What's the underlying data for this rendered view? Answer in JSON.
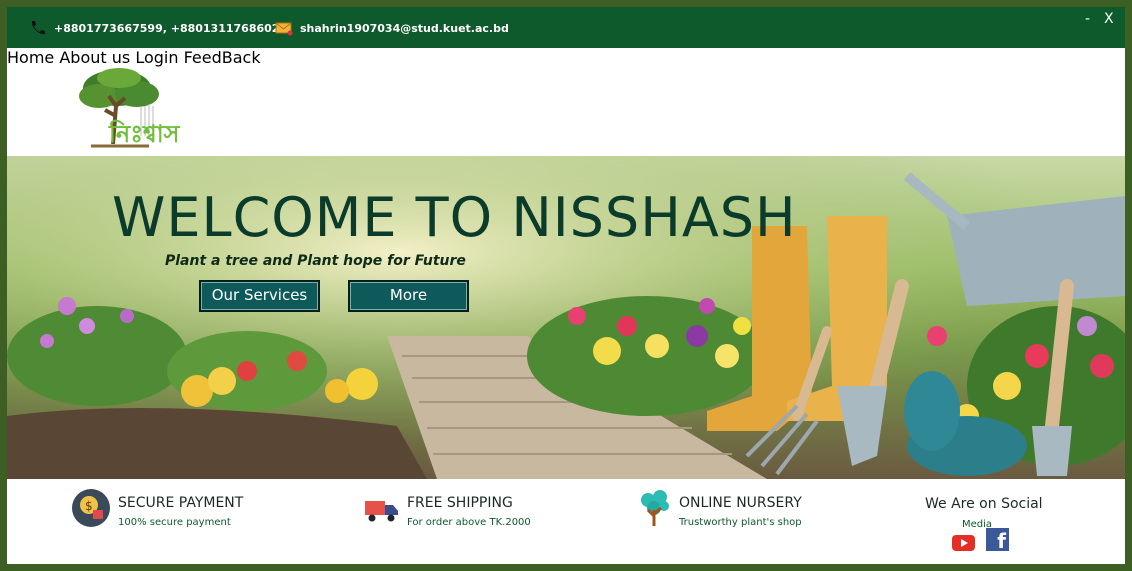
{
  "topbar": {
    "phone": "+8801773667599, +8801311768602",
    "email": "shahrin1907034@stud.kuet.ac.bd",
    "minimize": "-",
    "close": "X",
    "phone_icon": "phone-icon",
    "mail_icon": "mail-icon"
  },
  "header": {
    "logo_text": "নিঃশ্বাস",
    "nav": [
      "Home",
      "About us",
      "Login",
      "FeedBack"
    ]
  },
  "hero": {
    "title": "WELCOME TO NISSHASH",
    "tagline": "Plant a tree and Plant hope for Future",
    "buttons": {
      "services": "Our Services",
      "more": "More"
    }
  },
  "features": [
    {
      "title": "SECURE PAYMENT",
      "subtitle": "100% secure payment",
      "icon": "secure-payment-icon"
    },
    {
      "title": "FREE SHIPPING",
      "subtitle": "For order above TK.2000",
      "icon": "truck-icon"
    },
    {
      "title": "ONLINE NURSERY",
      "subtitle": "Trustworthy plant's shop",
      "icon": "tree-icon"
    }
  ],
  "social": {
    "title": "We Are on Social",
    "subtitle": "Media",
    "icons": [
      "youtube-icon",
      "facebook-icon"
    ]
  },
  "colors": {
    "brand_green": "#0e5a2c",
    "button_teal": "#0e5a5a",
    "title_dark": "#0b3b2a"
  }
}
